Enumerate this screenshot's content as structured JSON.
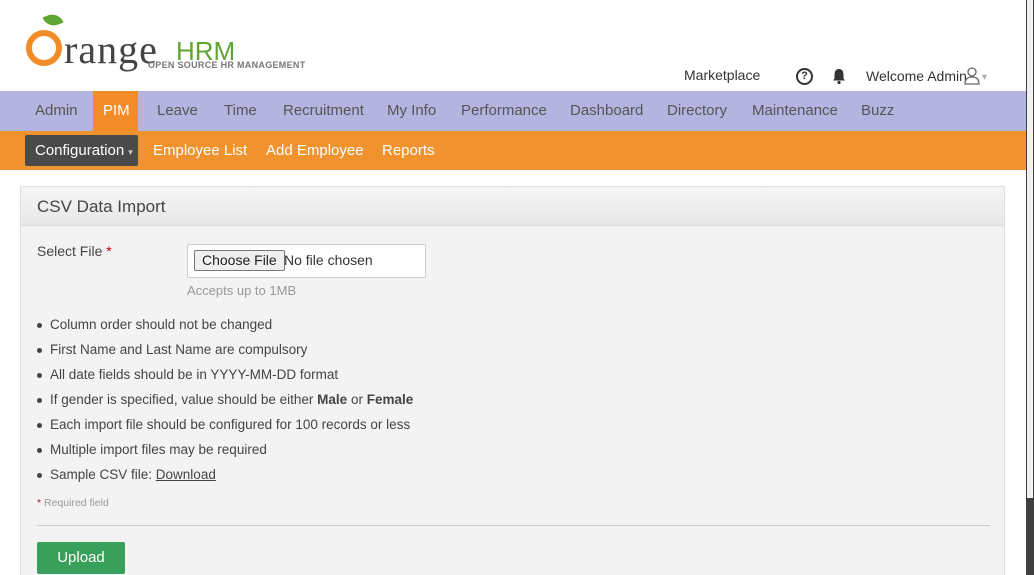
{
  "header": {
    "logo_main": "rangeHRM",
    "logo_word": "range",
    "logo_hrm": "HRM",
    "logo_tagline": "OPEN SOURCE HR MANAGEMENT",
    "marketplace": "Marketplace",
    "help_glyph": "?",
    "welcome": "Welcome Admin",
    "caret": "▾",
    "icons": [
      "help-icon",
      "bell-icon",
      "user-icon",
      "caret-down-icon"
    ]
  },
  "mainnav": {
    "items": [
      "Admin",
      "PIM",
      "Leave",
      "Time",
      "Recruitment",
      "My Info",
      "Performance",
      "Dashboard",
      "Directory",
      "Maintenance",
      "Buzz"
    ],
    "active": "PIM"
  },
  "subnav": {
    "configuration": "Configuration",
    "config_arrow": "▾",
    "employee_list": "Employee List",
    "add_employee": "Add Employee",
    "reports": "Reports"
  },
  "panel": {
    "title": "CSV Data Import",
    "select_file_label": "Select File",
    "required_star": "*",
    "choose_file": "Choose File",
    "no_file": "No file chosen",
    "hint": "Accepts up to 1MB",
    "notes": {
      "n1": "Column order should not be changed",
      "n2": "First Name and Last Name are compulsory",
      "n3": "All date fields should be in YYYY-MM-DD format",
      "n4_pre": "If gender is specified, value should be either ",
      "n4_male": "Male",
      "n4_or": " or ",
      "n4_female": "Female",
      "n5": "Each import file should be configured for 100 records or less",
      "n6": "Multiple import files may be required",
      "n7_pre": "Sample CSV file: ",
      "n7_link": "Download"
    },
    "required_note": "Required field",
    "upload": "Upload"
  },
  "colors": {
    "brand_orange": "#f28c28",
    "nav_purple": "#b4b4e0",
    "upload_green": "#38a05a"
  }
}
